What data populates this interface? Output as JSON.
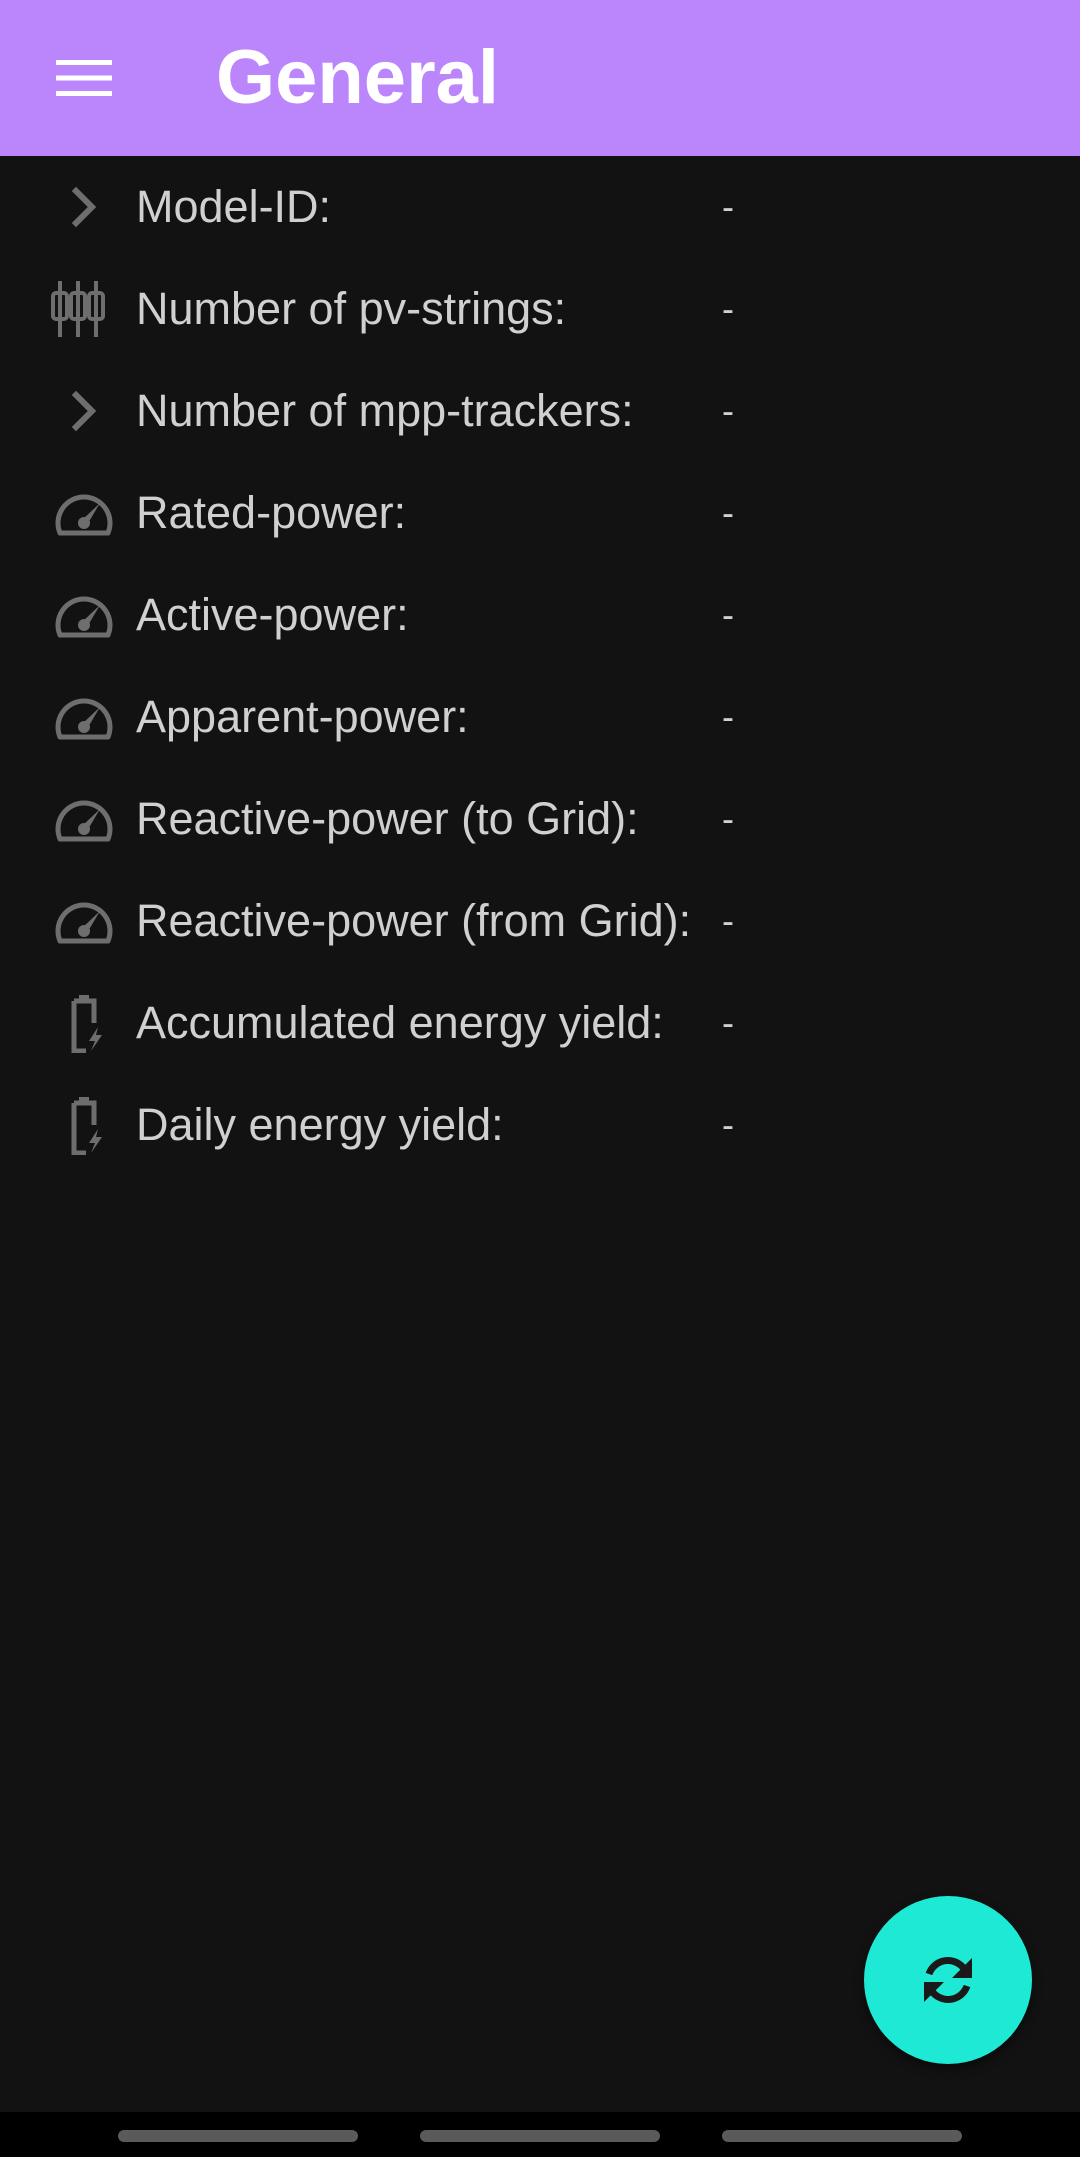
{
  "header": {
    "title": "General",
    "menu_icon": "hamburger-menu-icon"
  },
  "colors": {
    "accent": "#bb86fc",
    "fab": "#1de9d4",
    "background": "#121212",
    "text": "#d0d0d0",
    "icon": "#6e6e6e"
  },
  "rows": [
    {
      "icon": "chevron-right-icon",
      "label": "Model-ID:",
      "value": "-"
    },
    {
      "icon": "pv-strings-icon",
      "label": "Number of pv-strings:",
      "value": "-"
    },
    {
      "icon": "chevron-right-icon",
      "label": "Number of mpp-trackers:",
      "value": "-"
    },
    {
      "icon": "speedometer-icon",
      "label": "Rated-power:",
      "value": "-"
    },
    {
      "icon": "speedometer-icon",
      "label": "Active-power:",
      "value": "-"
    },
    {
      "icon": "speedometer-icon",
      "label": "Apparent-power:",
      "value": "-"
    },
    {
      "icon": "speedometer-icon",
      "label": "Reactive-power (to Grid):",
      "value": "-"
    },
    {
      "icon": "speedometer-icon",
      "label": "Reactive-power (from Grid):",
      "value": "-"
    },
    {
      "icon": "battery-charging-icon",
      "label": "Accumulated energy yield:",
      "value": "-"
    },
    {
      "icon": "battery-charging-icon",
      "label": "Daily energy yield:",
      "value": "-"
    }
  ],
  "fab": {
    "icon": "refresh-icon"
  }
}
